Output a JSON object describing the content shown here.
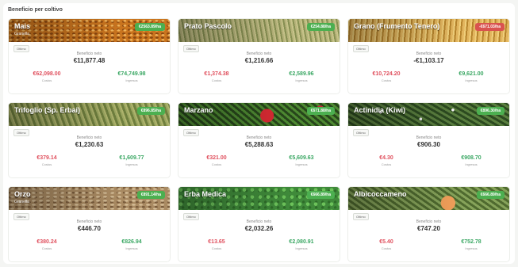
{
  "panel": {
    "title": "Beneficio per coltivo"
  },
  "cards": [
    {
      "name": "Mais",
      "sub": "Granella",
      "badge": "€2563.89/ha",
      "badge_neg": false,
      "tag": "Ottimo",
      "bn_label": "Beneficio neto",
      "bn_value": "€11,877.48",
      "cost": "€62,098.00",
      "cost_label": "Costos",
      "revenue": "€74,749.98",
      "revenue_label": "Ingresos",
      "texture": "grain"
    },
    {
      "name": "Prato Pascolo",
      "sub": "",
      "badge": "€254.88/ha",
      "badge_neg": false,
      "tag": "Ottimo",
      "bn_label": "Beneficio neto",
      "bn_value": "€1,216.66",
      "cost": "€1,374.38",
      "cost_label": "Costos",
      "revenue": "€2,589.96",
      "revenue_label": "Ingresos",
      "texture": "meadow"
    },
    {
      "name": "Grano (Frumento Tenero)",
      "sub": "",
      "badge": "-€671.03/ha",
      "badge_neg": true,
      "tag": "Ottimo",
      "bn_label": "Beneficio neto",
      "bn_value": "-€1,103.17",
      "cost": "€10,724.20",
      "cost_label": "Costos",
      "revenue": "€9,621.00",
      "revenue_label": "Ingresos",
      "texture": "wheat"
    },
    {
      "name": "Trifoglio (Sp. Erbai)",
      "sub": "",
      "badge": "€896.85/ha",
      "badge_neg": false,
      "tag": "Ottimo",
      "bn_label": "Beneficio neto",
      "bn_value": "€1,230.63",
      "cost": "€379.14",
      "cost_label": "Costos",
      "revenue": "€1,609.77",
      "revenue_label": "Ingresos",
      "texture": "clover"
    },
    {
      "name": "Marzano",
      "sub": "",
      "badge": "€671.88/ha",
      "badge_neg": false,
      "tag": "Ottimo",
      "bn_label": "Beneficio neto",
      "bn_value": "€5,288.63",
      "cost": "€321.00",
      "cost_label": "Costos",
      "revenue": "€5,609.63",
      "revenue_label": "Ingresos",
      "texture": "apple"
    },
    {
      "name": "Actinidia (Kiwi)",
      "sub": "",
      "badge": "€896.30/ha",
      "badge_neg": false,
      "tag": "Ottimo",
      "bn_label": "Beneficio neto",
      "bn_value": "€906.30",
      "cost": "€4.30",
      "cost_label": "Costos",
      "revenue": "€908.70",
      "revenue_label": "Ingresos",
      "texture": "kiwi"
    },
    {
      "name": "Orzo",
      "sub": "Granella",
      "badge": "€891.14/ha",
      "badge_neg": false,
      "tag": "Ottimo",
      "bn_label": "Beneficio neto",
      "bn_value": "€446.70",
      "cost": "€380.24",
      "cost_label": "Costos",
      "revenue": "€826.94",
      "revenue_label": "Ingresos",
      "texture": "oats"
    },
    {
      "name": "Erba Medica",
      "sub": "",
      "badge": "€666.89/ha",
      "badge_neg": false,
      "tag": "Ottimo",
      "bn_label": "Beneficio neto",
      "bn_value": "€2,032.26",
      "cost": "€13.65",
      "cost_label": "Costos",
      "revenue": "€2,080.91",
      "revenue_label": "Ingresos",
      "texture": "alfalfa"
    },
    {
      "name": "Albicoccameno",
      "sub": "",
      "badge": "€666.89/ha",
      "badge_neg": false,
      "tag": "Ottimo",
      "bn_label": "Beneficio neto",
      "bn_value": "€747.20",
      "cost": "€5.40",
      "cost_label": "Costos",
      "revenue": "€752.78",
      "revenue_label": "Ingresos",
      "texture": "apricot"
    }
  ]
}
